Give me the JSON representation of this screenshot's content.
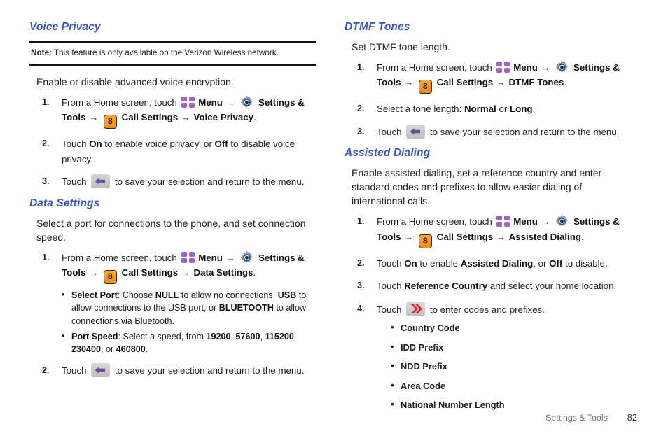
{
  "document": {
    "footer_section": "Settings & Tools",
    "page_number": "82"
  },
  "icons": {
    "menu": "menu-grid-icon",
    "settings": "gear-settings-icon",
    "call_settings_key": "8",
    "back": "back-arrow-icon",
    "forward": "double-chevron-right-icon",
    "arrow_separator": "→"
  },
  "colors": {
    "heading": "#3b55b8",
    "menu_icon": "#9b63c4",
    "key_icon": "#f79a1e",
    "chevron_icon": "#e02020",
    "rule": "#131313"
  },
  "left_column": {
    "voice_privacy": {
      "heading": "Voice Privacy",
      "note": {
        "label": "Note:",
        "text": "This feature is only available on the Verizon Wireless network."
      },
      "intro": "Enable or disable advanced voice encryption.",
      "steps": [
        {
          "num": "1.",
          "prefix": "From a Home screen, touch",
          "menu_label": "Menu",
          "settings_label": "Settings & Tools",
          "call_settings_label": "Call Settings",
          "target_label": "Voice Privacy",
          "period": "."
        },
        {
          "num": "2.",
          "text_a": "Touch ",
          "on": "On",
          "text_b": " to enable voice privacy, or ",
          "off": "Off",
          "text_c": " to disable voice privacy."
        },
        {
          "num": "3.",
          "text_a": "Touch ",
          "text_b": " to save your selection and return to the menu."
        }
      ]
    },
    "data_settings": {
      "heading": "Data Settings",
      "intro": "Select a port for connections to the phone, and set connection speed.",
      "steps": [
        {
          "num": "1.",
          "prefix": "From a Home screen, touch",
          "menu_label": "Menu",
          "settings_label": "Settings & Tools",
          "call_settings_label": "Call Settings",
          "target_label": "Data Settings",
          "period": "."
        },
        {
          "num": "2.",
          "text_a": "Touch ",
          "text_b": " to save your selection and return to the menu."
        }
      ],
      "bullets": [
        {
          "term": "Select Port",
          "sep": ": ",
          "t1": "Choose ",
          "v1": "NULL",
          "t2": " to allow no connections, ",
          "v2": "USB",
          "t3": " to allow connections to the USB port, or ",
          "v3": "BLUETOOTH",
          "t4": " to allow connections via Bluetooth."
        },
        {
          "term": "Port Speed",
          "sep": ": ",
          "t1": "Select a speed, from ",
          "v1": "19200",
          "t2": ", ",
          "v2": "57600",
          "t3": ", ",
          "v3": "115200",
          "t4": ", ",
          "v4": "230400",
          "t5": ", or ",
          "v5": "460800",
          "t6": "."
        }
      ]
    }
  },
  "right_column": {
    "dtmf_tones": {
      "heading": "DTMF Tones",
      "intro": "Set DTMF tone length.",
      "steps": [
        {
          "num": "1.",
          "prefix": "From a Home screen, touch",
          "menu_label": "Menu",
          "settings_label": "Settings & Tools",
          "call_settings_label": "Call Settings",
          "target_label": "DTMF Tones",
          "period": "."
        },
        {
          "num": "2.",
          "text_a": "Select a tone length: ",
          "v1": "Normal",
          "text_b": " or ",
          "v2": "Long",
          "text_c": "."
        },
        {
          "num": "3.",
          "text_a": "Touch ",
          "text_b": " to save your selection and return to the menu."
        }
      ]
    },
    "assisted_dialing": {
      "heading": "Assisted Dialing",
      "intro": "Enable assisted dialing, set a reference country and enter standard codes and prefixes to allow easier dialing of international calls.",
      "steps": [
        {
          "num": "1.",
          "prefix": "From a Home screen, touch",
          "menu_label": "Menu",
          "settings_label": "Settings & Tools",
          "call_settings_label": "Call Settings",
          "target_label": "Assisted Dialing",
          "period": "."
        },
        {
          "num": "2.",
          "text_a": "Touch ",
          "on": "On",
          "text_b": " to enable ",
          "v1": "Assisted Dialing",
          "text_c": ", or ",
          "off": "Off",
          "text_d": " to disable."
        },
        {
          "num": "3.",
          "text_a": "Touch ",
          "v1": "Reference Country",
          "text_b": " and select your home location."
        },
        {
          "num": "4.",
          "text_a": "Touch ",
          "text_b": " to enter codes and prefixes."
        }
      ],
      "sub_bullets": [
        "Country Code",
        "IDD Prefix",
        "NDD Prefix",
        "Area Code",
        "National Number Length"
      ]
    }
  }
}
